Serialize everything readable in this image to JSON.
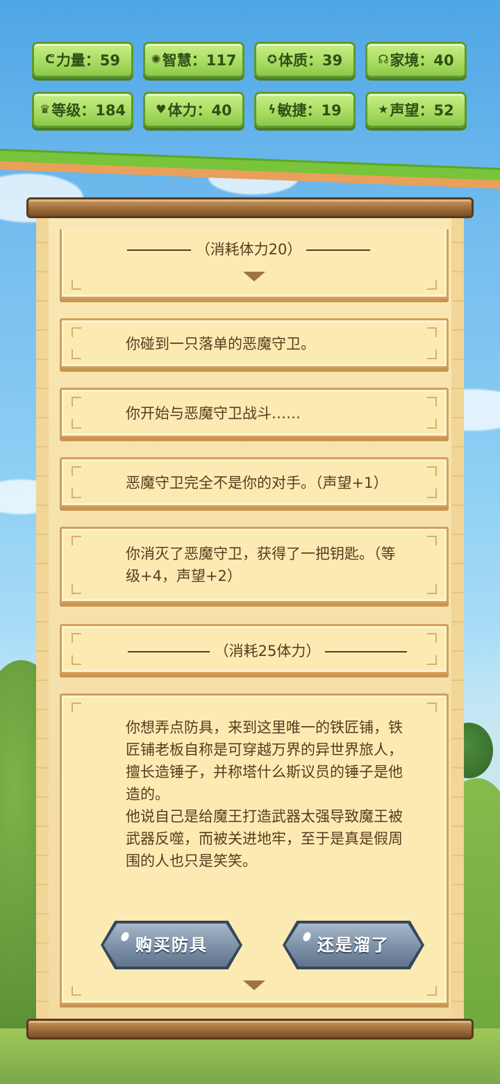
{
  "stats": [
    {
      "icon_name": "muscle-icon",
      "icon": "ᕦ",
      "label": "力量：59"
    },
    {
      "icon_name": "bulb-icon",
      "icon": "✺",
      "label": "智慧：117"
    },
    {
      "icon_name": "body-icon",
      "icon": "✪",
      "label": "体质：39"
    },
    {
      "icon_name": "family-icon",
      "icon": "☊",
      "label": "家境：40"
    },
    {
      "icon_name": "crown-icon",
      "icon": "♛",
      "label": "等级：184"
    },
    {
      "icon_name": "heart-icon",
      "icon": "♥",
      "label": "体力：40"
    },
    {
      "icon_name": "lightning-icon",
      "icon": "ϟ",
      "label": "敏捷：19"
    },
    {
      "icon_name": "star-icon",
      "icon": "★",
      "label": "声望：52"
    }
  ],
  "log": {
    "divider_top": "（消耗体力20）",
    "event1": "你碰到一只落单的恶魔守卫。",
    "event2": "你开始与恶魔守卫战斗……",
    "event3": "恶魔守卫完全不是你的对手。（声望+1）",
    "event4_line1": "你消灭了恶魔守卫，获得了一把钥匙。（等",
    "event4_line2": "级+4，声望+2）",
    "divider_bottom": "（消耗25体力）",
    "story": [
      "你想弄点防具，来到这里唯一的铁匠铺，铁",
      "匠铺老板自称是可穿越万界的异世界旅人，",
      "擅长造锤子，并称塔什么斯议员的锤子是他",
      "造的。",
      "他说自己是给魔王打造武器太强导致魔王被",
      "武器反噬，而被关进地牢，至于是真是假周",
      "围的人也只是笑笑。"
    ]
  },
  "buttons": {
    "buy": "购买防具",
    "leave": "还是溜了"
  },
  "colors": {
    "stat_bg": "#a9dd64",
    "card_bg": "#fbebb3",
    "text": "#5a3a1e",
    "button": "#7f93aa"
  }
}
